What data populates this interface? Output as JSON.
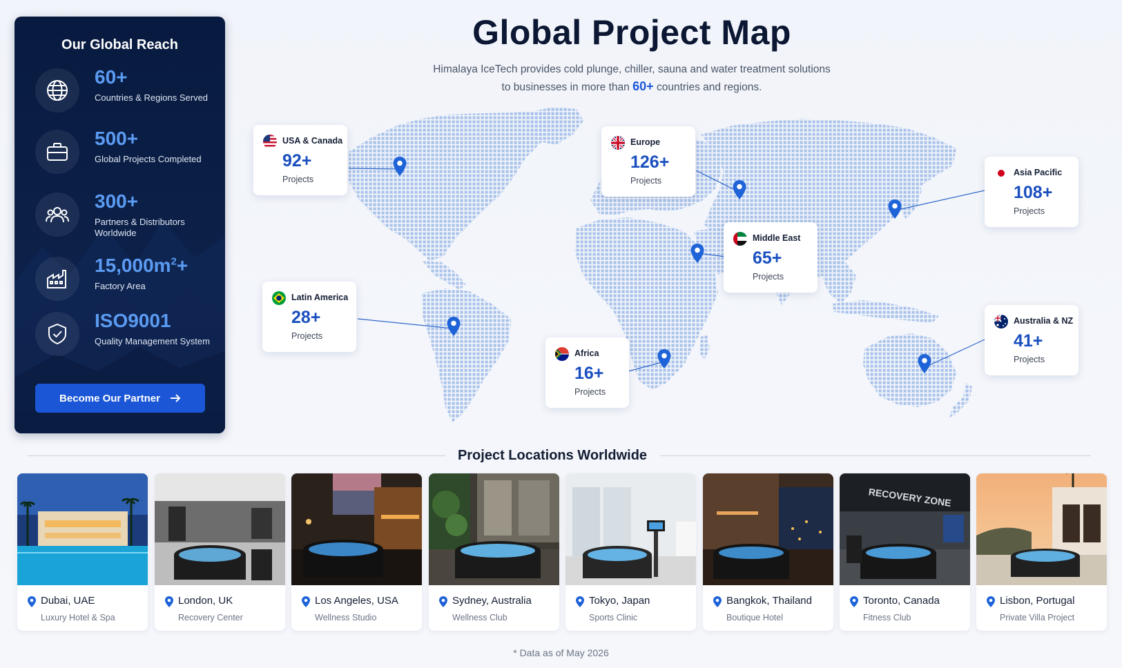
{
  "stats_panel": {
    "title": "Our Global Reach",
    "stats": [
      {
        "icon": "globe-icon",
        "value": "60+",
        "label": "Countries & Regions Served"
      },
      {
        "icon": "briefcase-icon",
        "value": "500+",
        "label": "Global Projects Completed"
      },
      {
        "icon": "people-icon",
        "value": "300+",
        "label": "Partners & Distributors Worldwide"
      },
      {
        "icon": "factory-icon",
        "value": "15,000m",
        "value_sup": "2",
        "value_suffix": "+",
        "label": "Factory Area"
      },
      {
        "icon": "shield-check-icon",
        "value": "ISO9001",
        "label": "Quality Management System"
      }
    ],
    "cta_label": "Become Our Partner",
    "cta_icon": "arrow-right-icon"
  },
  "header": {
    "title": "Global Project Map",
    "subtitle_line1": "Himalaya IceTech provides cold plunge, chiller, sauna and water treatment solutions",
    "subtitle_line2_pre": "to businesses in more than",
    "subtitle_highlight": "60+",
    "subtitle_line2_post": "countries and regions."
  },
  "regions": [
    {
      "name": "USA & Canada",
      "value": "92+",
      "unit": "Projects",
      "flag": "us-flag-icon"
    },
    {
      "name": "Europe",
      "value": "126+",
      "unit": "Projects",
      "flag": "uk-flag-icon"
    },
    {
      "name": "Asia Pacific",
      "value": "108+",
      "unit": "Projects",
      "flag": "japan-flag-icon"
    },
    {
      "name": "Middle East",
      "value": "65+",
      "unit": "Projects",
      "flag": "uae-flag-icon"
    },
    {
      "name": "Latin America",
      "value": "28+",
      "unit": "Projects",
      "flag": "brazil-flag-icon"
    },
    {
      "name": "Africa",
      "value": "16+",
      "unit": "Projects",
      "flag": "south-africa-flag-icon"
    },
    {
      "name": "Australia & NZ",
      "value": "41+",
      "unit": "Projects",
      "flag": "australia-flag-icon"
    }
  ],
  "locations": {
    "section_title": "Project Locations Worldwide",
    "items": [
      {
        "city": "Dubai, UAE",
        "type": "Luxury Hotel & Spa"
      },
      {
        "city": "London, UK",
        "type": "Recovery Center"
      },
      {
        "city": "Los Angeles, USA",
        "type": "Wellness Studio"
      },
      {
        "city": "Sydney, Australia",
        "type": "Wellness Club"
      },
      {
        "city": "Tokyo, Japan",
        "type": "Sports Clinic"
      },
      {
        "city": "Bangkok, Thailand",
        "type": "Boutique Hotel"
      },
      {
        "city": "Toronto, Canada",
        "type": "Fitness Club"
      },
      {
        "city": "Lisbon, Portugal",
        "type": "Private Villa Project"
      }
    ]
  },
  "footnote": "* Data as of May 2026",
  "colors": {
    "accent": "#1a56d6",
    "stat_value": "#5b9bf2",
    "panel_bg": "#0b1f47",
    "map_dot": "#a9c2ea",
    "pin": "#1e63d8"
  }
}
